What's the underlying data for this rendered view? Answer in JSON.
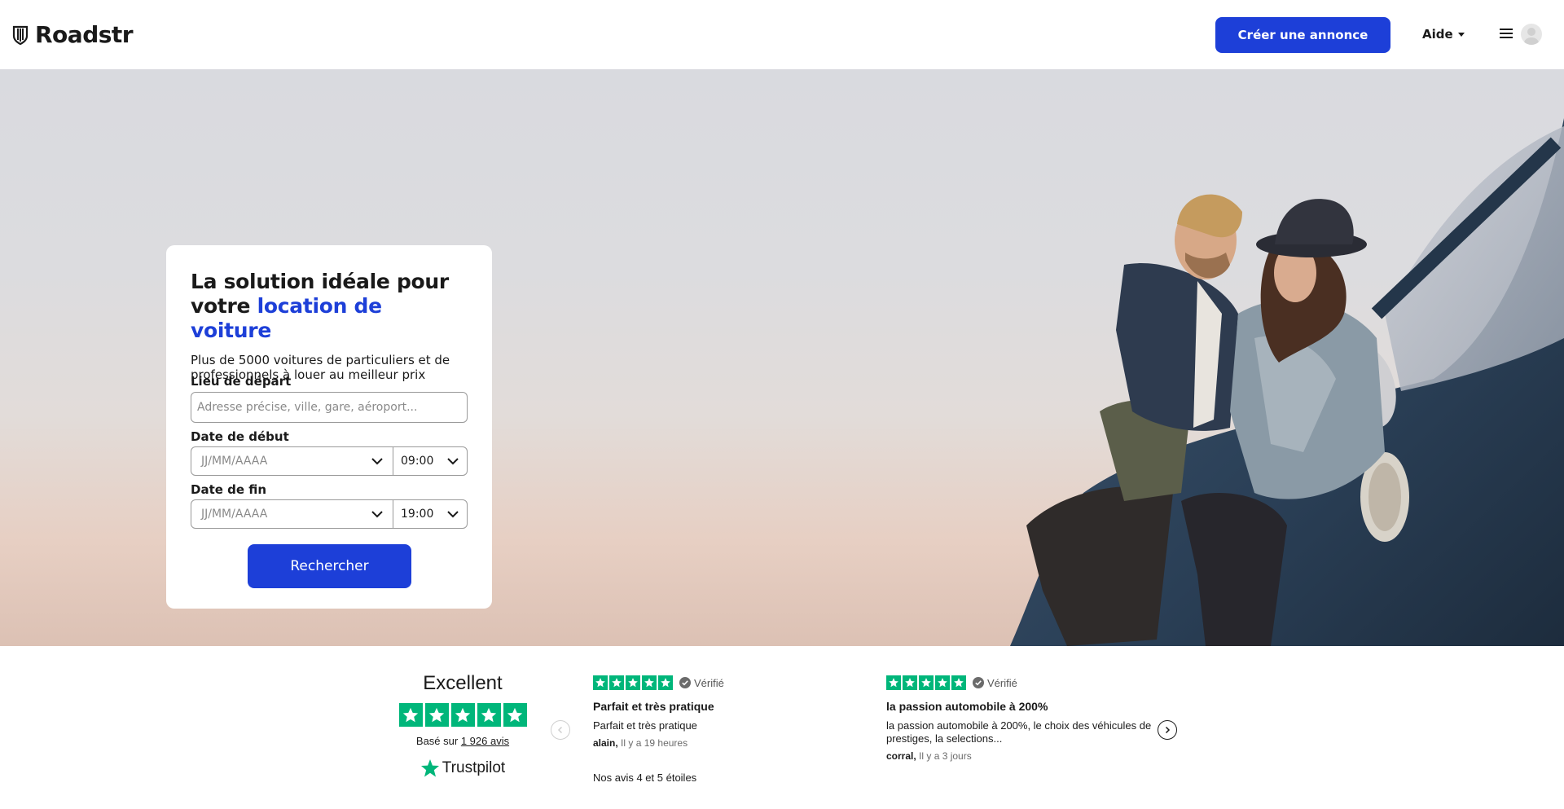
{
  "header": {
    "brand": "Roadstr",
    "create_listing": "Créer une annonce",
    "help": "Aide"
  },
  "search": {
    "title_part1": "La solution idéale pour votre ",
    "title_accent": "location de voiture",
    "subtitle": "Plus de 5000 voitures de particuliers et de professionnels à louer au meilleur prix",
    "departure_label": "Lieu de départ",
    "departure_placeholder": "Adresse précise, ville, gare, aéroport...",
    "start_label": "Date de début",
    "start_date_placeholder": "JJ/MM/AAAA",
    "start_time": "09:00",
    "end_label": "Date de fin",
    "end_date_placeholder": "JJ/MM/AAAA",
    "end_time": "19:00",
    "submit": "Rechercher"
  },
  "trustpilot": {
    "rating_word": "Excellent",
    "based_on_prefix": "Basé sur ",
    "review_count_link": "1 926 avis",
    "brand": "Trustpilot",
    "star_color": "#00b67a",
    "footnote": "Nos avis 4 et 5 étoiles",
    "reviews": [
      {
        "stars": 5,
        "verified": "Vérifié",
        "title": "Parfait et très pratique",
        "body": "Parfait et très pratique",
        "author": "alain,",
        "time": "Il y a 19 heures"
      },
      {
        "stars": 5,
        "verified": "Vérifié",
        "title": "la passion automobile à 200%",
        "body": "la passion automobile à 200%, le choix des véhicules de prestiges, la selections...",
        "author": "corral,",
        "time": "Il y a 3 jours"
      }
    ]
  },
  "colors": {
    "brand_blue": "#1d3fd8"
  }
}
